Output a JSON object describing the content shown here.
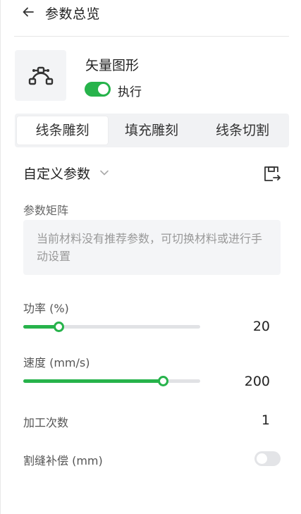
{
  "header": {
    "title": "参数总览",
    "back_icon": "arrow-left-icon"
  },
  "layer": {
    "icon": "vector-bezier-icon",
    "name": "矢量图形",
    "execute_toggle": {
      "on": true,
      "label": "执行"
    }
  },
  "tabs": [
    {
      "label": "线条雕刻",
      "active": true
    },
    {
      "label": "填充雕刻",
      "active": false
    },
    {
      "label": "线条切割",
      "active": false
    }
  ],
  "preset": {
    "label": "自定义参数",
    "chevron_icon": "chevron-down-icon",
    "save_icon": "save-export-icon"
  },
  "matrix": {
    "label": "参数矩阵",
    "notice": "当前材料没有推荐参数，可切换材料或进行手动设置"
  },
  "params": {
    "power": {
      "label": "功率 (%)",
      "value": "20",
      "fraction": 0.2
    },
    "speed": {
      "label": "速度 (mm/s)",
      "value": "200",
      "fraction": 0.79
    },
    "passes": {
      "label": "加工次数",
      "value": "1"
    },
    "kerf": {
      "label": "割缝补偿 (mm)",
      "on": false
    }
  },
  "colors": {
    "accent": "#27b34b",
    "track": "#e1e2e5",
    "panel_bg": "#f1f2f4"
  }
}
